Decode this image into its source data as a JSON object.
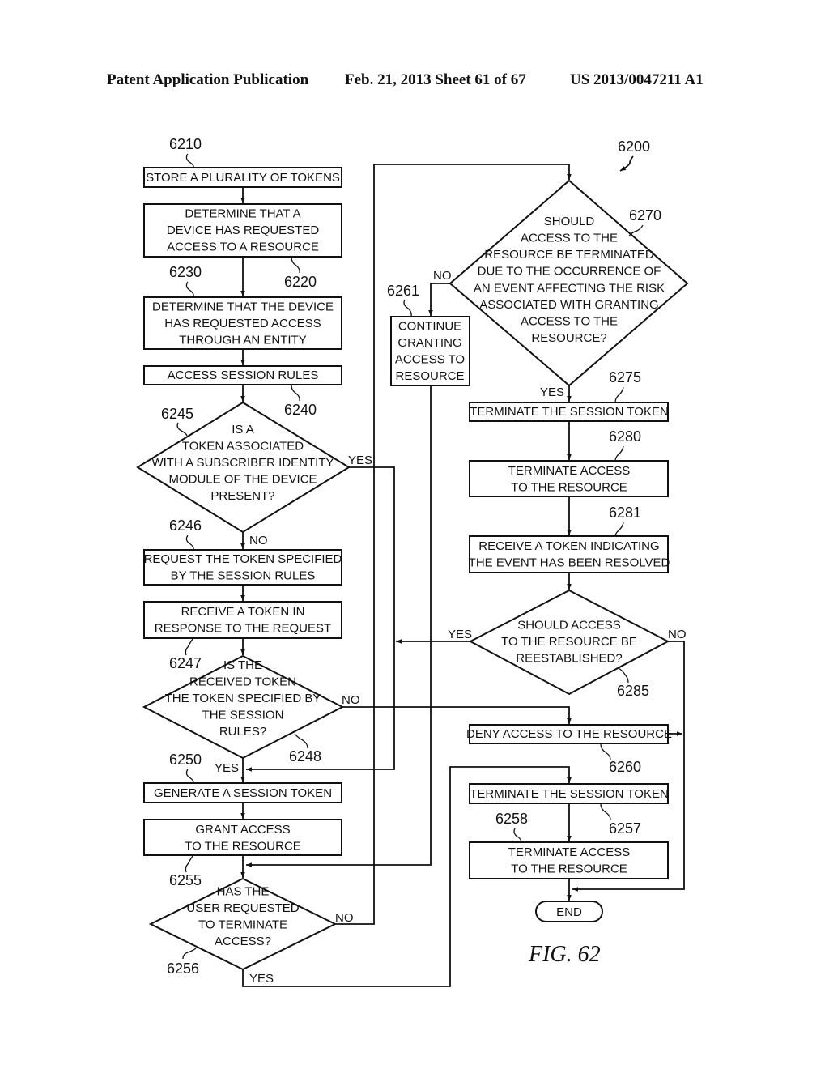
{
  "header": {
    "left": "Patent Application Publication",
    "middle": "Feb. 21, 2013   Sheet 61 of 67",
    "right": "US 2013/0047211 A1"
  },
  "figure": {
    "label": "FIG. 62",
    "ref": "6200"
  },
  "nodes": {
    "n6210": {
      "ref": "6210",
      "type": "process",
      "lines": [
        "STORE A PLURALITY OF TOKENS"
      ]
    },
    "n6220": {
      "ref": "6220",
      "type": "process",
      "lines": [
        "DETERMINE THAT A",
        "DEVICE HAS REQUESTED",
        "ACCESS TO A RESOURCE"
      ]
    },
    "n6230": {
      "ref": "6230",
      "type": "process",
      "lines": [
        "DETERMINE THAT THE DEVICE",
        "HAS REQUESTED ACCESS",
        "THROUGH AN ENTITY"
      ]
    },
    "n6240": {
      "ref": "6240",
      "type": "process",
      "lines": [
        "ACCESS SESSION RULES"
      ]
    },
    "n6245": {
      "ref": "6245",
      "type": "decision",
      "lines": [
        "IS A",
        "TOKEN ASSOCIATED",
        "WITH A SUBSCRIBER IDENTITY",
        "MODULE OF THE DEVICE",
        "PRESENT?"
      ]
    },
    "n6246": {
      "ref": "6246",
      "type": "process",
      "lines": [
        "REQUEST THE TOKEN SPECIFIED",
        "BY THE SESSION RULES"
      ]
    },
    "n6247": {
      "ref": "6247",
      "type": "process",
      "lines": [
        "RECEIVE A TOKEN IN",
        "RESPONSE TO THE REQUEST"
      ]
    },
    "n6248": {
      "ref": "6248",
      "type": "decision",
      "lines": [
        "IS THE",
        "RECEIVED TOKEN",
        "THE TOKEN SPECIFIED BY",
        "THE SESSION",
        "RULES?"
      ]
    },
    "n6250": {
      "ref": "6250",
      "type": "process",
      "lines": [
        "GENERATE A SESSION TOKEN"
      ]
    },
    "n6255": {
      "ref": "6255",
      "type": "process",
      "lines": [
        "GRANT ACCESS",
        "TO THE RESOURCE"
      ]
    },
    "n6256": {
      "ref": "6256",
      "type": "decision",
      "lines": [
        "HAS THE",
        "USER REQUESTED",
        "TO TERMINATE",
        "ACCESS?"
      ]
    },
    "n6261": {
      "ref": "6261",
      "type": "process",
      "lines": [
        "CONTINUE",
        "GRANTING",
        "ACCESS TO",
        "RESOURCE"
      ]
    },
    "n6270": {
      "ref": "6270",
      "type": "decision",
      "lines": [
        "SHOULD",
        "ACCESS TO THE",
        "RESOURCE BE TERMINATED",
        "DUE TO THE OCCURRENCE OF",
        "AN EVENT AFFECTING THE RISK",
        "ASSOCIATED WITH GRANTING",
        "ACCESS TO THE",
        "RESOURCE?"
      ]
    },
    "n6275": {
      "ref": "6275",
      "type": "process",
      "lines": [
        "TERMINATE THE SESSION TOKEN"
      ]
    },
    "n6280": {
      "ref": "6280",
      "type": "process",
      "lines": [
        "TERMINATE ACCESS",
        "TO THE RESOURCE"
      ]
    },
    "n6281": {
      "ref": "6281",
      "type": "process",
      "lines": [
        "RECEIVE A TOKEN INDICATING",
        "THE EVENT HAS BEEN RESOLVED"
      ]
    },
    "n6285": {
      "ref": "6285",
      "type": "decision",
      "lines": [
        "SHOULD ACCESS",
        "TO THE RESOURCE BE",
        "REESTABLISHED?"
      ]
    },
    "n6260": {
      "ref": "6260",
      "type": "process",
      "lines": [
        "DENY ACCESS TO THE RESOURCE"
      ]
    },
    "n6257": {
      "ref": "6257",
      "type": "process",
      "lines": [
        "TERMINATE THE SESSION TOKEN"
      ]
    },
    "n6258": {
      "ref": "6258",
      "type": "process",
      "lines": [
        "TERMINATE ACCESS",
        "TO THE RESOURCE"
      ]
    },
    "end": {
      "type": "terminator",
      "lines": [
        "END"
      ]
    }
  },
  "edge_labels": {
    "e6245_yes": "YES",
    "e6245_no": "NO",
    "e6248_no": "NO",
    "e6248_yes": "YES",
    "e6256_no": "NO",
    "e6256_yes": "YES",
    "e6270_no": "NO",
    "e6270_yes": "YES",
    "e6285_yes": "YES",
    "e6285_no": "NO"
  }
}
